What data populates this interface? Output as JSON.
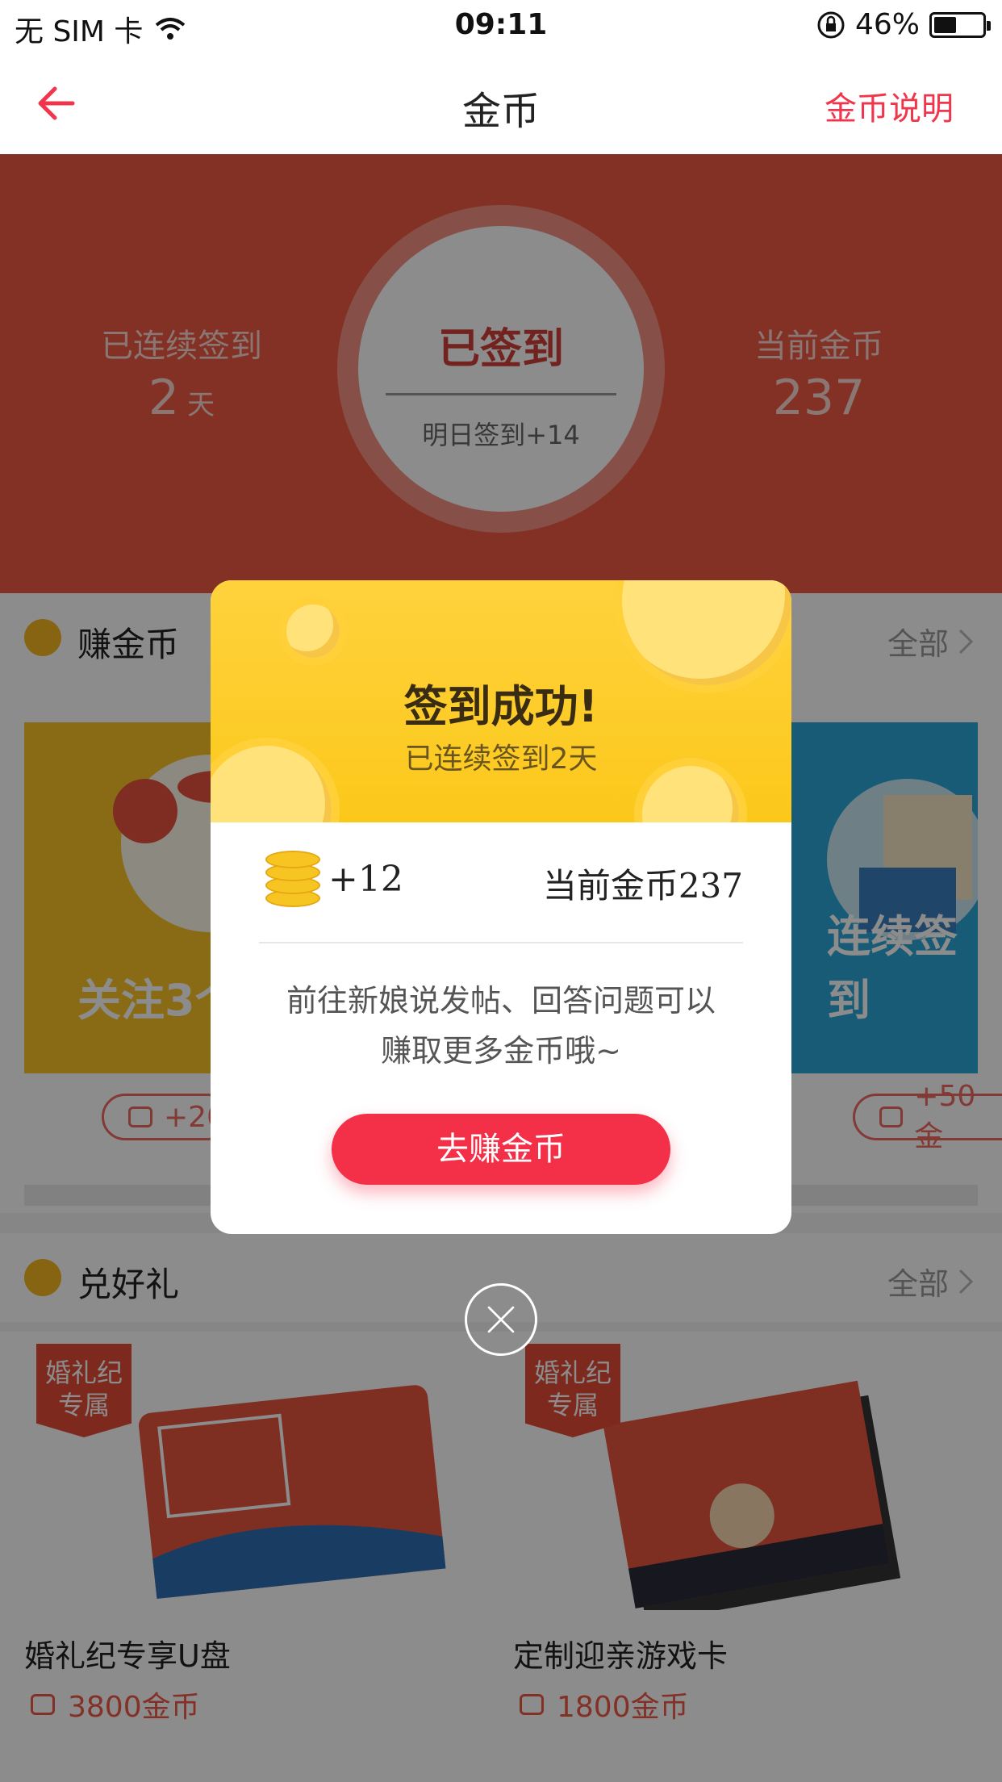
{
  "status_bar": {
    "carrier": "无 SIM 卡",
    "time": "09:11",
    "battery_pct": "46%",
    "battery_level": 0.46
  },
  "nav": {
    "title": "金币",
    "help": "金币说明"
  },
  "hero": {
    "streak_label": "已连续签到",
    "streak_value": "2",
    "streak_unit": "天",
    "signed_label": "已签到",
    "tomorrow": "明日签到+14",
    "coins_label": "当前金币",
    "coins_value": "237"
  },
  "earn": {
    "title": "赚金币",
    "more": "全部",
    "cards": [
      {
        "caption": "关注3个",
        "reward": "+20"
      },
      {
        "caption": "连续签到",
        "reward": "+50金"
      }
    ]
  },
  "gifts": {
    "title": "兑好礼",
    "more": "全部",
    "items": [
      {
        "badge_line1": "婚礼纪",
        "badge_line2": "专属",
        "name": "婚礼纪专享U盘",
        "price": "3800金币"
      },
      {
        "badge_line1": "婚礼纪",
        "badge_line2": "专属",
        "name": "定制迎亲游戏卡",
        "price": "1800金币"
      }
    ]
  },
  "dialog": {
    "title": "签到成功!",
    "subtitle": "已连续签到2天",
    "gain": "+12",
    "current": "当前金币237",
    "desc_line1": "前往新娘说发帖、回答问题可以",
    "desc_line2": "赚取更多金币哦~",
    "cta": "去赚金币"
  },
  "colors": {
    "brand_red": "#f42f48",
    "hero_red": "#ee5a44",
    "gold": "#fbc81a"
  },
  "icons": [
    "wifi-icon",
    "rotation-lock-icon",
    "back-arrow-icon",
    "coin-icon",
    "gift-icon",
    "chevron-right-icon",
    "close-icon"
  ]
}
